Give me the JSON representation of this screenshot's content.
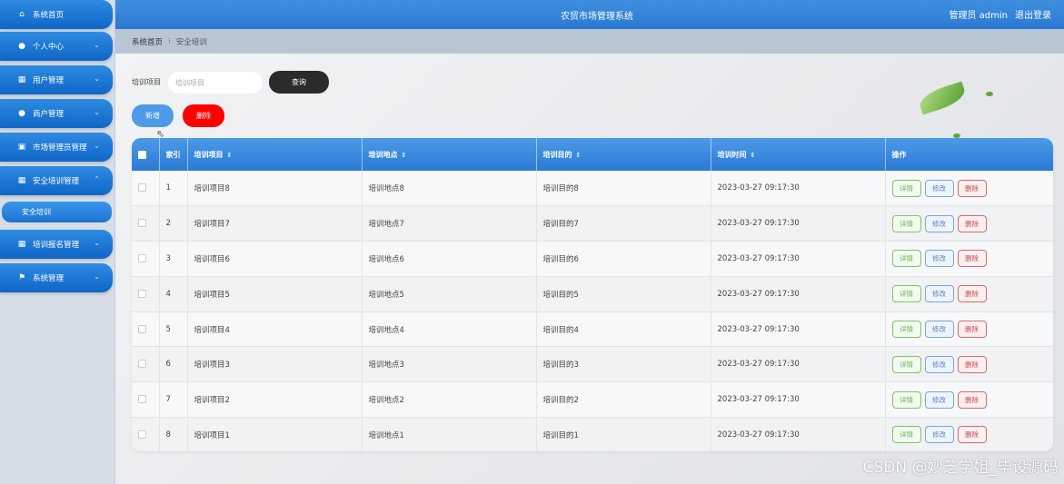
{
  "header": {
    "title": "农贸市场管理系统",
    "user_label": "管理员 admin",
    "logout_label": "退出登录"
  },
  "sidebar": {
    "items": [
      {
        "label": "系统首页",
        "icon": "home-icon"
      },
      {
        "label": "个人中心",
        "icon": "person-icon"
      },
      {
        "label": "用户管理",
        "icon": "grid-icon"
      },
      {
        "label": "商户管理",
        "icon": "person-icon"
      },
      {
        "label": "市场管理员管理",
        "icon": "calendar-icon"
      },
      {
        "label": "安全培训管理",
        "icon": "grid-icon"
      },
      {
        "label": "培训报名管理",
        "icon": "grid-icon"
      },
      {
        "label": "系统管理",
        "icon": "flag-icon"
      }
    ],
    "sub_item": "安全培训"
  },
  "breadcrumb": {
    "home": "系统首页",
    "separator": "⁝",
    "current": "安全培训"
  },
  "search": {
    "label": "培训项目",
    "placeholder": "培训项目",
    "query_button": "查询"
  },
  "actions": {
    "add_button": "新增",
    "delete_button": "删除"
  },
  "table": {
    "headers": [
      "索引",
      "培训项目",
      "培训地点",
      "培训目的",
      "培训时间",
      "操作"
    ],
    "rows": [
      {
        "index": "1",
        "project": "培训项目8",
        "location": "培训地点8",
        "purpose": "培训目的8",
        "time": "2023-03-27 09:17:30"
      },
      {
        "index": "2",
        "project": "培训项目7",
        "location": "培训地点7",
        "purpose": "培训目的7",
        "time": "2023-03-27 09:17:30"
      },
      {
        "index": "3",
        "project": "培训项目6",
        "location": "培训地点6",
        "purpose": "培训目的6",
        "time": "2023-03-27 09:17:30"
      },
      {
        "index": "4",
        "project": "培训项目5",
        "location": "培训地点5",
        "purpose": "培训目的5",
        "time": "2023-03-27 09:17:30"
      },
      {
        "index": "5",
        "project": "培训项目4",
        "location": "培训地点4",
        "purpose": "培训目的4",
        "time": "2023-03-27 09:17:30"
      },
      {
        "index": "6",
        "project": "培训项目3",
        "location": "培训地点3",
        "purpose": "培训目的3",
        "time": "2023-03-27 09:17:30"
      },
      {
        "index": "7",
        "project": "培训项目2",
        "location": "培训地点2",
        "purpose": "培训目的2",
        "time": "2023-03-27 09:17:30"
      },
      {
        "index": "8",
        "project": "培训项目1",
        "location": "培训地点1",
        "purpose": "培训目的1",
        "time": "2023-03-27 09:17:30"
      }
    ],
    "row_actions": {
      "detail": "详情",
      "edit": "修改",
      "delete": "删除"
    },
    "sort_icon": "sort-icon"
  },
  "watermark": "CSDN @妙芝学姐_毕设源码",
  "colors": {
    "primary": "#2a78d2",
    "danger": "#ff0000",
    "query_button": "#2b2b2b",
    "detail": "#6aaf55",
    "edit": "#5a86c4",
    "delete": "#c94c4c"
  }
}
